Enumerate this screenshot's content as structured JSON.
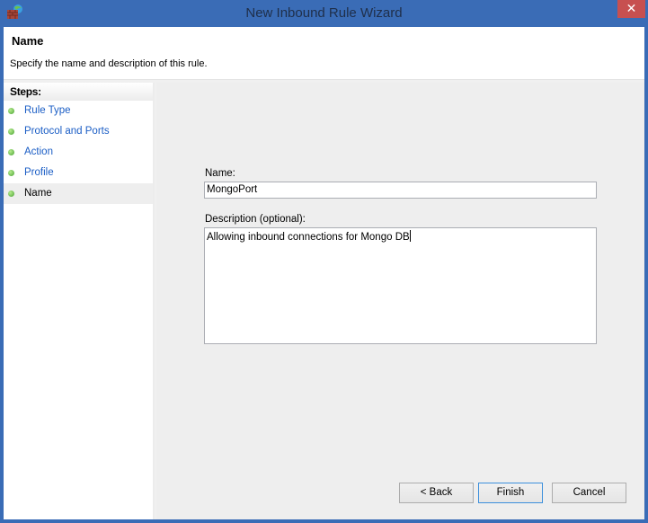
{
  "window": {
    "title": "New Inbound Rule Wizard",
    "icon": "firewall-icon",
    "close_label": "✕"
  },
  "header": {
    "title": "Name",
    "subtitle": "Specify the name and description of this rule."
  },
  "steps": {
    "heading": "Steps:",
    "items": [
      {
        "label": "Rule Type",
        "current": false
      },
      {
        "label": "Protocol and Ports",
        "current": false
      },
      {
        "label": "Action",
        "current": false
      },
      {
        "label": "Profile",
        "current": false
      },
      {
        "label": "Name",
        "current": true
      }
    ]
  },
  "form": {
    "name_label": "Name:",
    "name_value": "MongoPort",
    "description_label": "Description (optional):",
    "description_value": "Allowing inbound connections for Mongo DB"
  },
  "buttons": {
    "back": "< Back",
    "finish": "Finish",
    "cancel": "Cancel"
  }
}
